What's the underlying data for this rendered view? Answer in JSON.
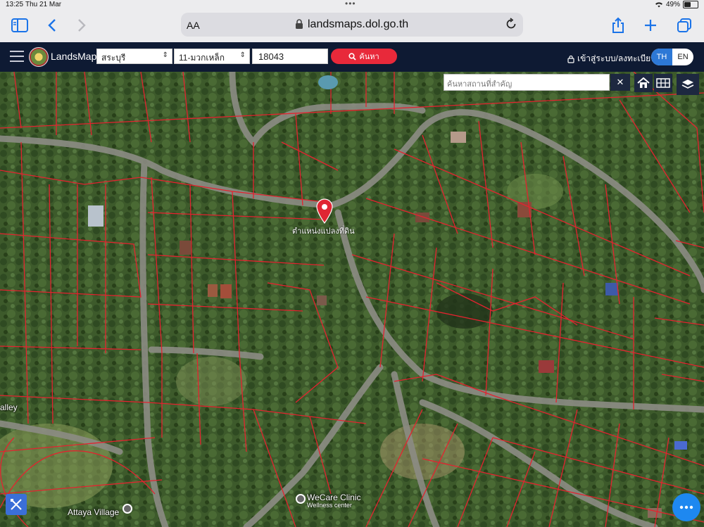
{
  "status_bar": {
    "time": "13:25",
    "date": "Thu 21 Mar",
    "battery": "49%",
    "battery_level": 0.49
  },
  "browser": {
    "aa_label": "AA",
    "url": "landsmaps.dol.go.th"
  },
  "header": {
    "brand": "LandsMaps",
    "province": "สระบุรี",
    "district": "11-มวกเหล็ก",
    "parcel_number": "18043",
    "search_label": "ค้นหา",
    "login_label": "เข้าสู่ระบบ/ลงทะเบียน",
    "lang_th": "TH",
    "lang_en": "EN",
    "active_lang": "TH"
  },
  "map": {
    "place_search_placeholder": "ค้นหาสถานที่สำคัญ",
    "clear_label": "✕",
    "pin_label": "ตำแหน่งแปลงที่ดิน",
    "places": {
      "valley": "alley",
      "attaya": "Attaya Village",
      "wecare": "WeCare Clinic",
      "wecare_sub": "Wellness center"
    },
    "colors": {
      "parcel_line": "#e3232f",
      "pin": "#e02633",
      "fab": "#1e88f0"
    }
  }
}
